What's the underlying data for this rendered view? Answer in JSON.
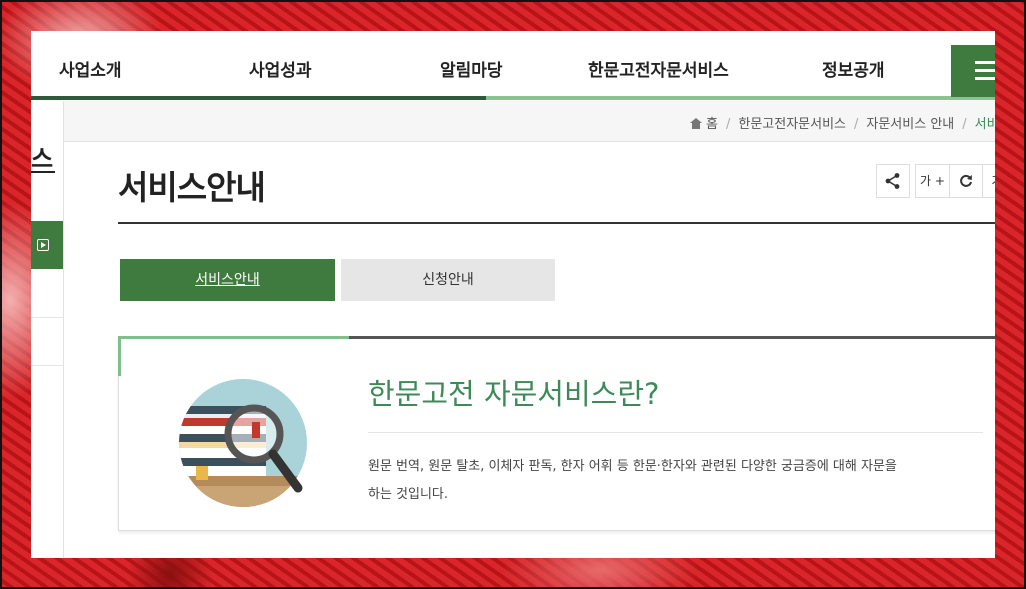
{
  "nav": {
    "items": [
      "사업소개",
      "사업성과",
      "알림마당",
      "한문고전자문서비스",
      "정보공개"
    ],
    "menu_icon": "hamburger-menu-icon"
  },
  "sidebar": {
    "title": "스",
    "play_icon": "play-box-icon"
  },
  "breadcrumb": {
    "home_icon": "home-icon",
    "items": [
      "홈",
      "한문고전자문서비스",
      "자문서비스 안내",
      "서비스안"
    ]
  },
  "page": {
    "title": "서비스안내"
  },
  "tools": {
    "share_icon": "share-icon",
    "font_increase_label": "가 +",
    "refresh_icon": "refresh-icon",
    "font_decrease_label": "가"
  },
  "tabs": [
    {
      "label": "서비스안내",
      "active": true
    },
    {
      "label": "신청안내",
      "active": false
    }
  ],
  "intro": {
    "title": "한문고전 자문서비스란?",
    "description_line1": "원문 번역, 원문 탈초, 이체자 판독, 한자 어휘 등 한문·한자와 관련된 다양한 궁금증에 대해 자문을",
    "description_line2": "하는 것입니다.",
    "illustration_icon": "magnifier-books-icon"
  },
  "colors": {
    "accent_green": "#3f7a3e",
    "title_green": "#3d8a58",
    "light_green": "#8dc18f"
  }
}
